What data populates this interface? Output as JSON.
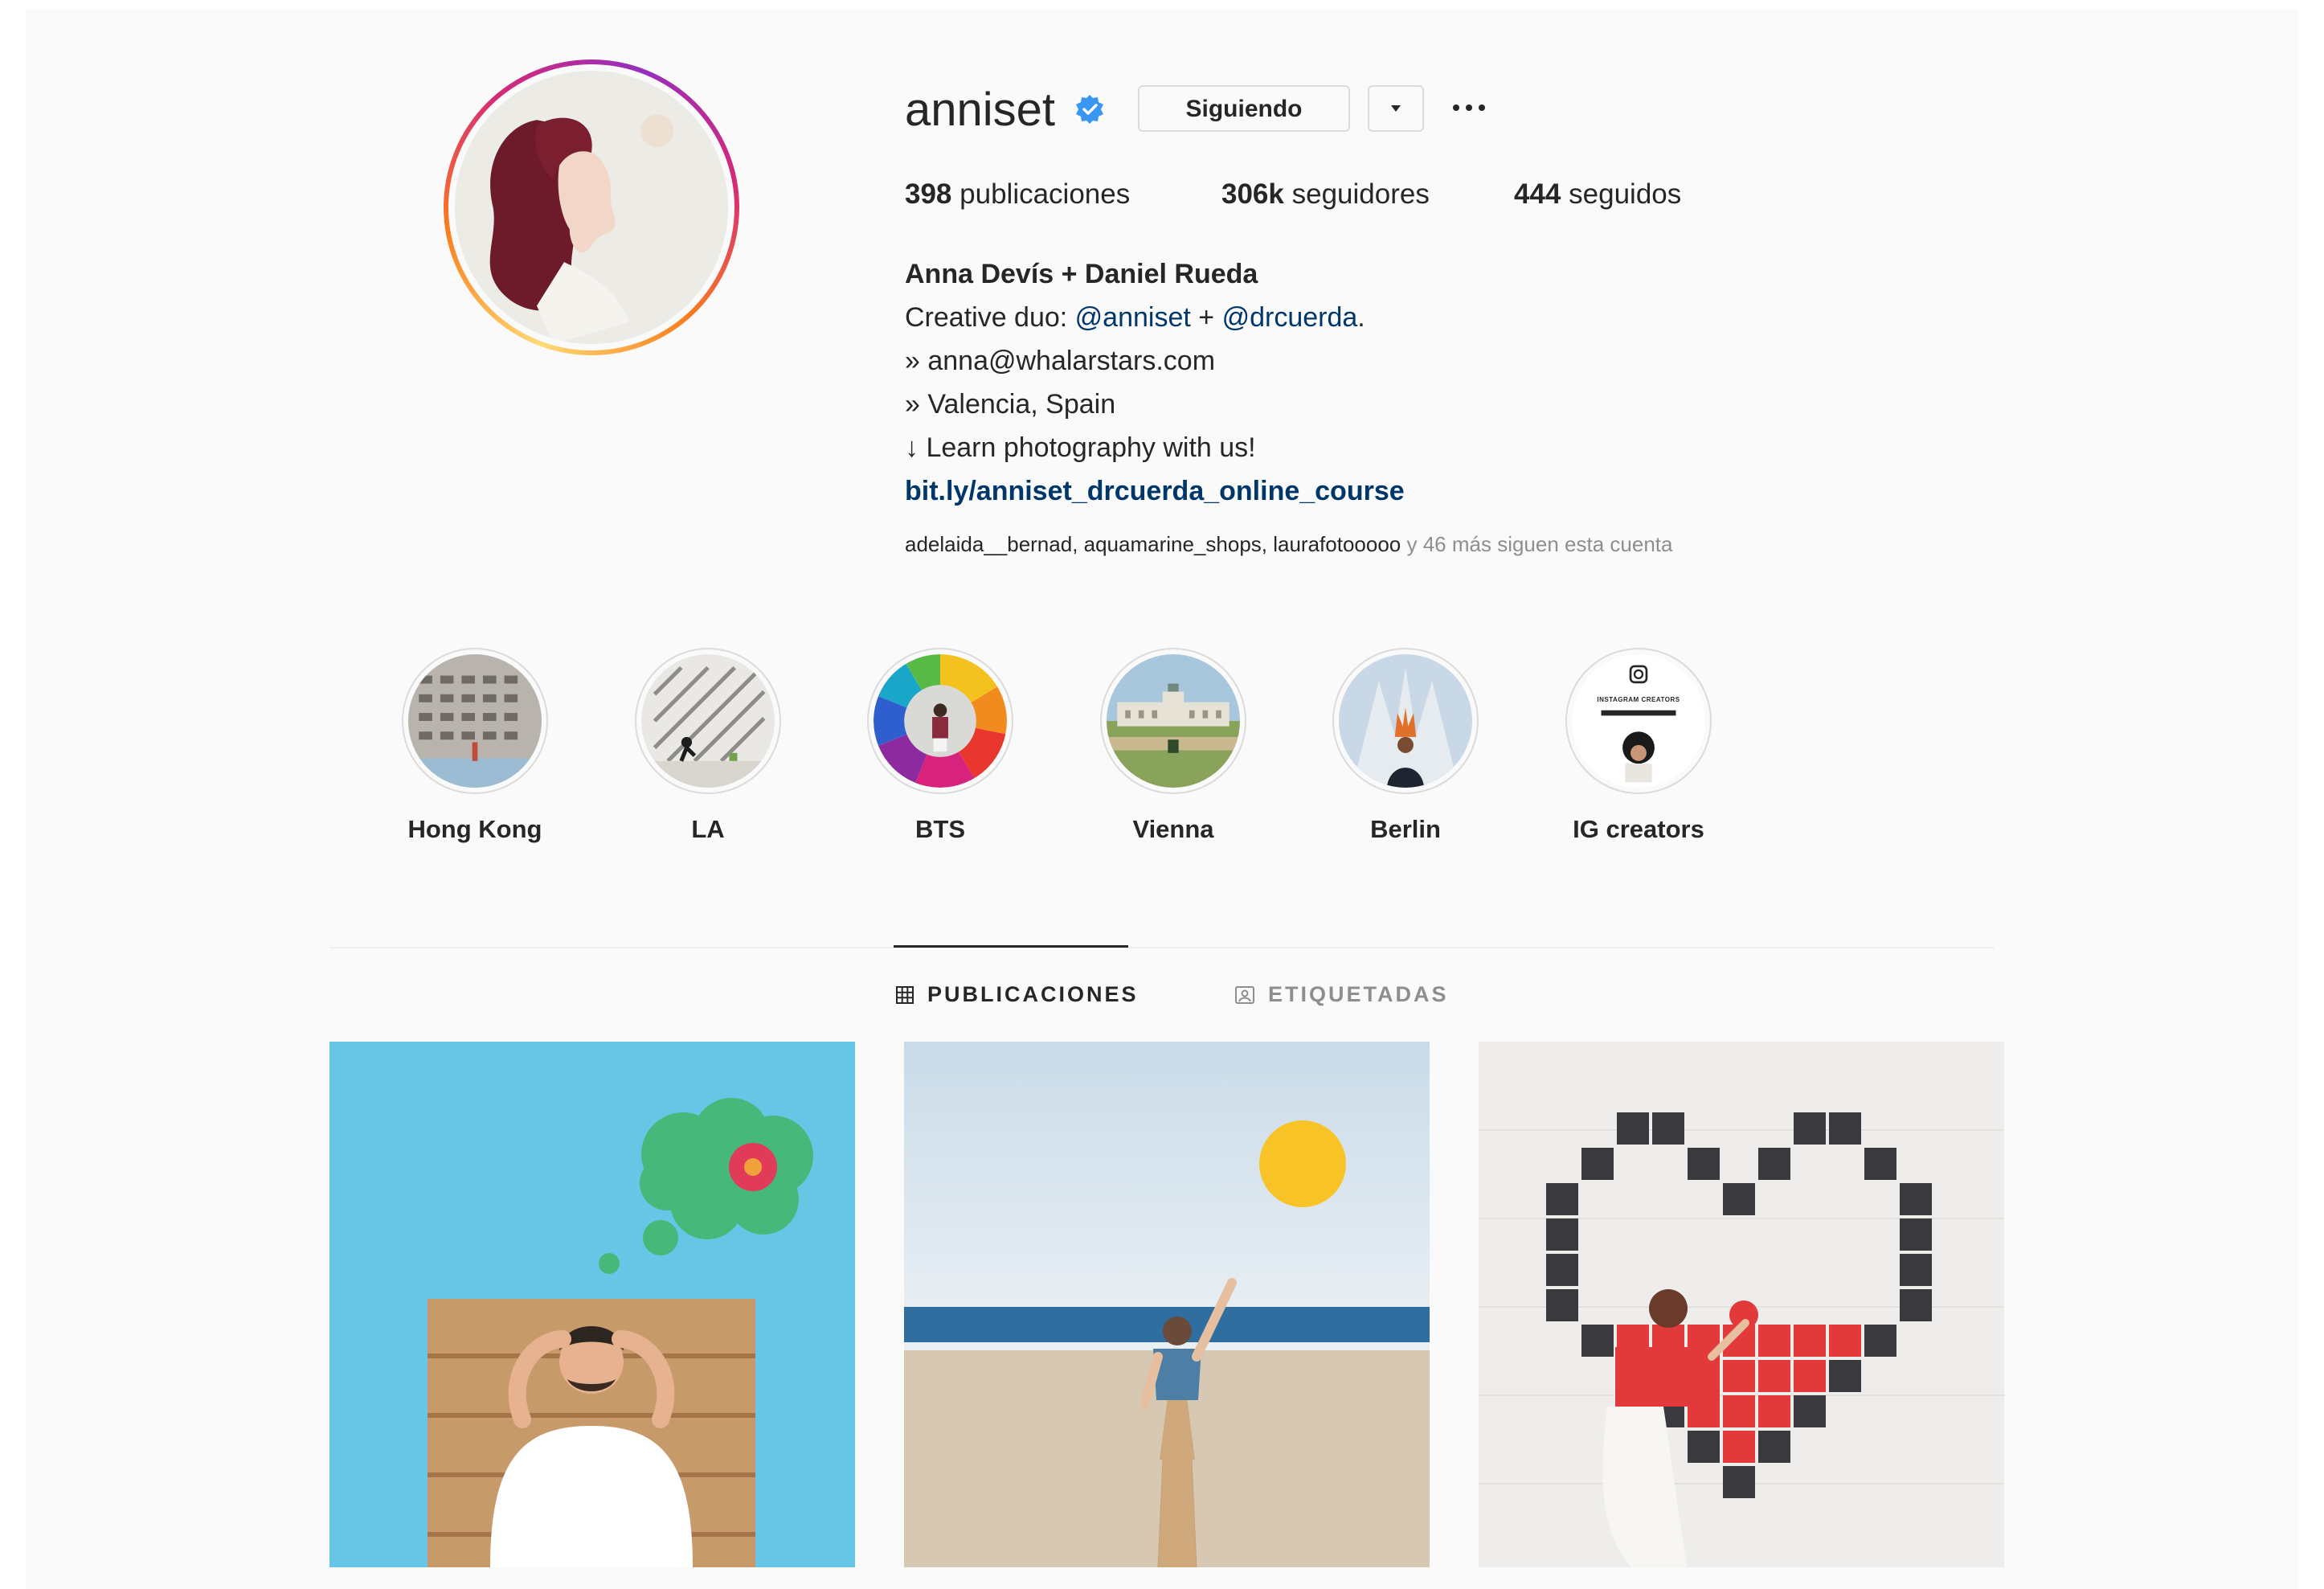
{
  "profile": {
    "username": "anniset",
    "follow_button": "Siguiendo",
    "stats": {
      "posts_count": "398",
      "posts_label": "publicaciones",
      "followers_count": "306k",
      "followers_label": "seguidores",
      "following_count": "444",
      "following_label": "seguidos"
    },
    "bio": {
      "name": "Anna Devís + Daniel Rueda",
      "line1_prefix": "Creative duo: ",
      "mention1": "@anniset",
      "line1_mid": " + ",
      "mention2": "@drcuerda",
      "line1_suffix": ".",
      "line2": "» anna@whalarstars.com",
      "line3": "» Valencia, Spain",
      "line4": "↓ Learn photography with us!",
      "link": "bit.ly/anniset_drcuerda_online_course"
    },
    "followed_by": {
      "names": "adelaida__bernad, aquamarine_shops, laurafotooooo",
      "more": " y 46 más siguen esta cuenta"
    }
  },
  "highlights": [
    {
      "label": "Hong Kong"
    },
    {
      "label": "LA"
    },
    {
      "label": "BTS"
    },
    {
      "label": "Vienna"
    },
    {
      "label": "Berlin"
    },
    {
      "label": "IG creators",
      "thumb_text": "INSTAGRAM CREATORS"
    }
  ],
  "tabs": {
    "posts": "PUBLICACIONES",
    "tagged": "ETIQUETADAS"
  },
  "colors": {
    "link": "#00376b",
    "verified": "#3897f0",
    "muted": "#8e8e8e",
    "text": "#262626"
  }
}
